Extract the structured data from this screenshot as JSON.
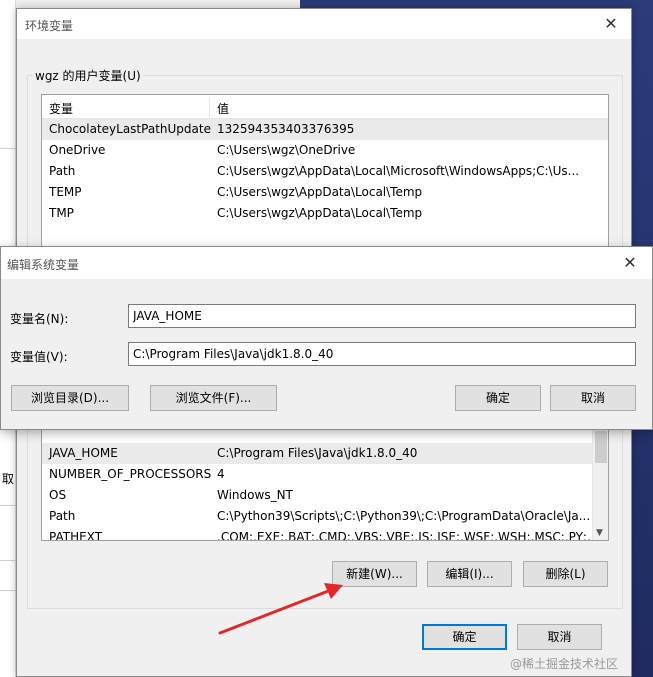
{
  "env_window": {
    "title": "环境变量",
    "close_glyph": "✕",
    "user_group_label": "wgz 的用户变量(U)",
    "columns": {
      "name": "变量",
      "value": "值"
    },
    "user_rows": [
      {
        "name": "ChocolateyLastPathUpdate",
        "value": "132594353403376395"
      },
      {
        "name": "OneDrive",
        "value": "C:\\Users\\wgz\\OneDrive"
      },
      {
        "name": "Path",
        "value": "C:\\Users\\wgz\\AppData\\Local\\Microsoft\\WindowsApps;C:\\Us..."
      },
      {
        "name": "TEMP",
        "value": "C:\\Users\\wgz\\AppData\\Local\\Temp"
      },
      {
        "name": "TMP",
        "value": "C:\\Users\\wgz\\AppData\\Local\\Temp"
      }
    ],
    "system_rows": [
      {
        "name": "JAVA_HOME",
        "value": "C:\\Program Files\\Java\\jdk1.8.0_40"
      },
      {
        "name": "NUMBER_OF_PROCESSORS",
        "value": "4"
      },
      {
        "name": "OS",
        "value": "Windows_NT"
      },
      {
        "name": "Path",
        "value": "C:\\Python39\\Scripts\\;C:\\Python39\\;C:\\ProgramData\\Oracle\\Ja..."
      },
      {
        "name": "PATHEXT",
        "value": ".COM;.EXE;.BAT;.CMD;.VBS;.VBE;.JS;.JSE;.WSF;.WSH;.MSC;.PY;.P..."
      }
    ],
    "buttons": {
      "new": "新建(W)...",
      "edit": "编辑(I)...",
      "delete": "删除(L)",
      "ok": "确定",
      "cancel": "取消"
    }
  },
  "edit_dialog": {
    "title": "编辑系统变量",
    "close_glyph": "✕",
    "name_label": "变量名(N):",
    "name_value": "JAVA_HOME",
    "value_label": "变量值(V):",
    "value_value": "C:\\Program Files\\Java\\jdk1.8.0_40",
    "buttons": {
      "browse_dir": "浏览目录(D)...",
      "browse_file": "浏览文件(F)...",
      "ok": "确定",
      "cancel": "取消"
    }
  },
  "background": {
    "left_fragment": "取"
  },
  "watermark": "@稀土掘金技术社区",
  "colors": {
    "accent": "#0078d7",
    "arrow": "#e0282a",
    "desktop": "#23326e"
  }
}
